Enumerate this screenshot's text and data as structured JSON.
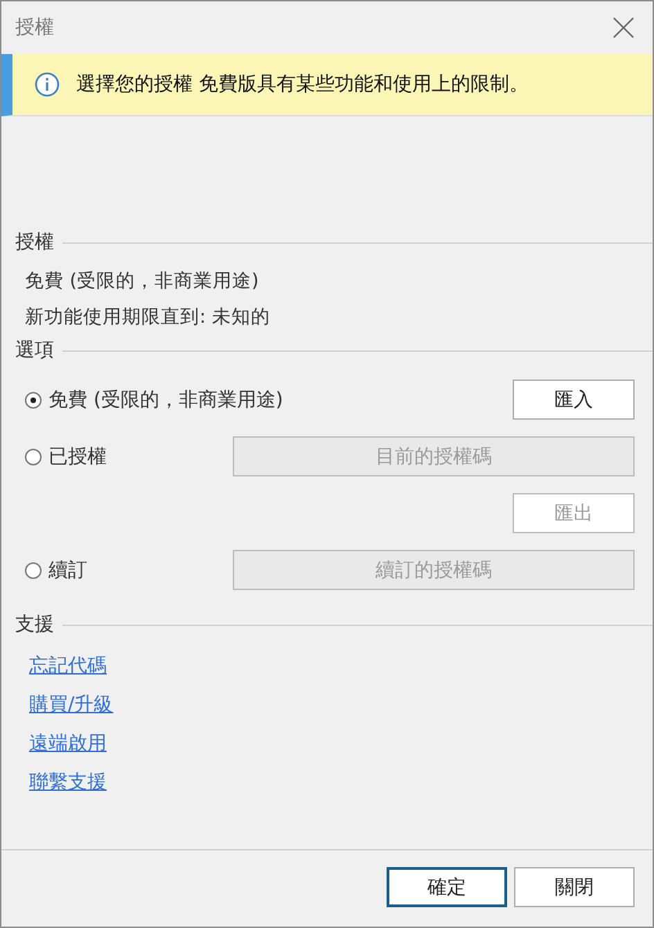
{
  "window": {
    "title": "授權"
  },
  "banner": {
    "message": "選擇您的授權 免費版具有某些功能和使用上的限制。"
  },
  "license": {
    "heading": "授權",
    "lines": [
      "免費 (受限的，非商業用途)",
      "新功能使用期限直到: 未知的"
    ]
  },
  "options": {
    "heading": "選項",
    "rows": [
      {
        "kind": "radio",
        "label": "免費 (受限的，非商業用途)",
        "selected": true,
        "button": {
          "label": "匯入",
          "kind": "narrow",
          "disabled": false
        }
      },
      {
        "kind": "radio",
        "label": "已授權",
        "selected": false,
        "button": {
          "label": "目前的授權碼",
          "kind": "wide",
          "disabled": true
        }
      },
      {
        "kind": "action",
        "button": {
          "label": "匯出",
          "kind": "narrow",
          "disabled": true
        }
      },
      {
        "kind": "radio",
        "label": "續訂",
        "selected": false,
        "button": {
          "label": "續訂的授權碼",
          "kind": "wide",
          "disabled": true
        }
      }
    ]
  },
  "support": {
    "heading": "支援",
    "links": [
      "忘記代碼",
      "購買/升級",
      "遠端啟用",
      "聯繫支援"
    ]
  },
  "footer": {
    "buttons": [
      {
        "label": "確定",
        "primary": true
      },
      {
        "label": "關閉",
        "primary": false
      }
    ]
  }
}
